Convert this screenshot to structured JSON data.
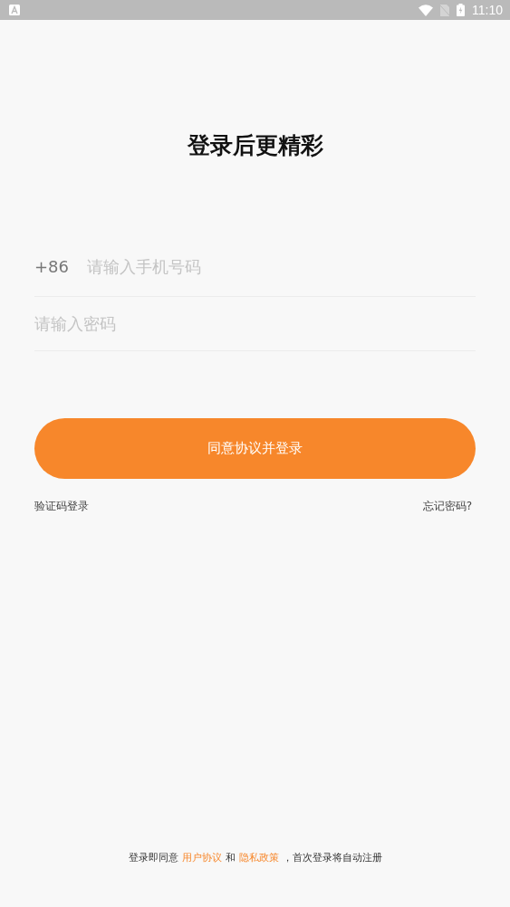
{
  "status_bar": {
    "time": "11:10"
  },
  "title": "登录后更精彩",
  "phone": {
    "prefix": "+86",
    "placeholder": "请输入手机号码"
  },
  "password": {
    "placeholder": "请输入密码"
  },
  "login_button": "同意协议并登录",
  "links": [
    {
      "label": "验证码登录"
    },
    {
      "label": "忘记密码?"
    }
  ],
  "footer": [
    {
      "kind": "text",
      "text": "登录即同意"
    },
    {
      "kind": "link",
      "text": "用户协议"
    },
    {
      "kind": "text",
      "text": "和"
    },
    {
      "kind": "link",
      "text": "隐私政策"
    },
    {
      "kind": "text",
      "text": "，首次登录将自动注册"
    }
  ]
}
